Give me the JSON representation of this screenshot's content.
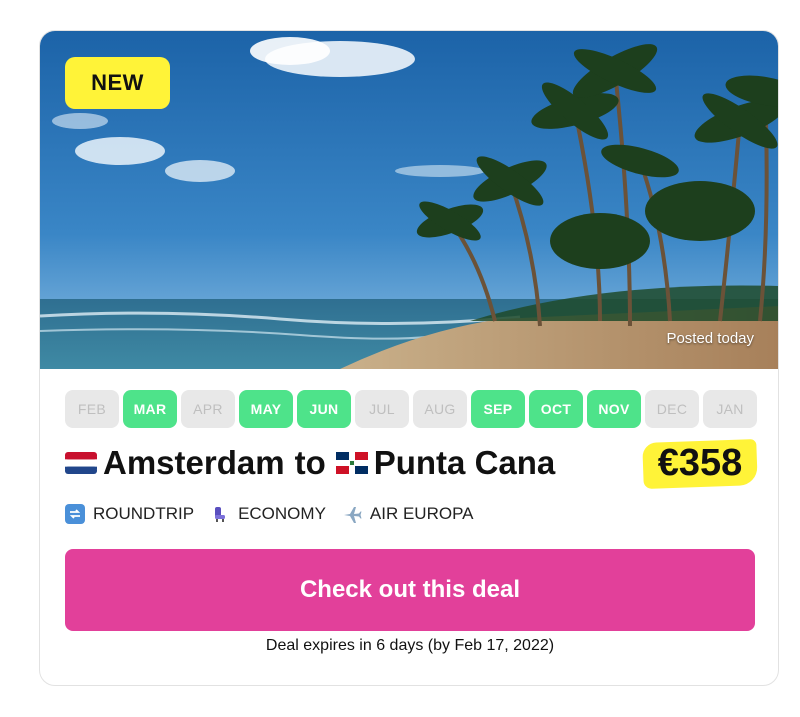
{
  "badge": {
    "label": "NEW",
    "color": "#fff338"
  },
  "hero": {
    "posted": "Posted today"
  },
  "months": [
    {
      "label": "FEB",
      "available": false
    },
    {
      "label": "MAR",
      "available": true
    },
    {
      "label": "APR",
      "available": false
    },
    {
      "label": "MAY",
      "available": true
    },
    {
      "label": "JUN",
      "available": true
    },
    {
      "label": "JUL",
      "available": false
    },
    {
      "label": "AUG",
      "available": false
    },
    {
      "label": "SEP",
      "available": true
    },
    {
      "label": "OCT",
      "available": true
    },
    {
      "label": "NOV",
      "available": true
    },
    {
      "label": "DEC",
      "available": false
    },
    {
      "label": "JAN",
      "available": false
    }
  ],
  "route": {
    "origin": "Amsterdam",
    "origin_flag": "netherlands-flag-icon",
    "connector": "to",
    "destination": "Punta Cana",
    "destination_flag": "dominican-republic-flag-icon",
    "price": "€358"
  },
  "meta": {
    "trip_type": "ROUNDTRIP",
    "trip_icon": "repeat-icon",
    "cabin": "ECONOMY",
    "cabin_icon": "seat-icon",
    "airline": "AIR EUROPA",
    "airline_icon": "airplane-icon"
  },
  "cta": {
    "label": "Check out this deal",
    "color": "#e2409a"
  },
  "expires": "Deal expires in 6 days (by Feb 17, 2022)",
  "colors": {
    "available_month": "#4ee38a",
    "unavailable_month": "#e8e8e8"
  }
}
